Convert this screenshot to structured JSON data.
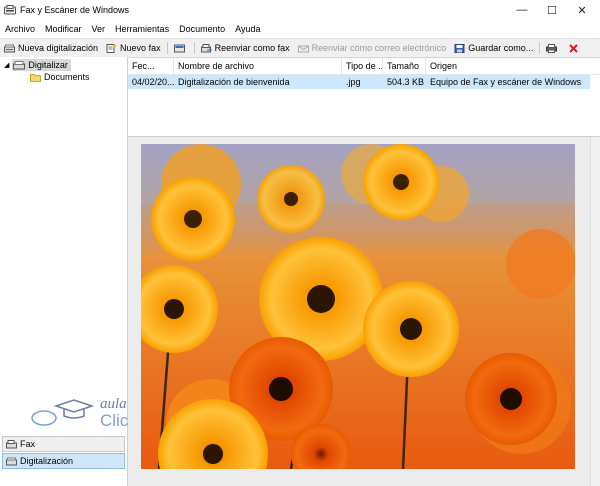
{
  "window": {
    "title": "Fax y Escáner de Windows",
    "minimize": "—",
    "maximize": "☐",
    "close": "✕"
  },
  "menu": [
    "Archivo",
    "Modificar",
    "Ver",
    "Herramientas",
    "Documento",
    "Ayuda"
  ],
  "toolbar": {
    "new_scan": "Nueva digitalización",
    "new_fax": "Nuevo fax",
    "forward_fax": "Reenviar como fax",
    "forward_email": "Reenviar como correo electrónico",
    "save_as": "Guardar como..."
  },
  "tree": {
    "root": "Digitalizar",
    "child": "Documents"
  },
  "nav": {
    "fax": "Fax",
    "scan": "Digitalización"
  },
  "watermark": {
    "text1": "aula",
    "text2": "Clic"
  },
  "file_list": {
    "columns": [
      "Fec...",
      "Nombre de archivo",
      "Tipo de ...",
      "Tamaño",
      "Origen"
    ],
    "rows": [
      {
        "date": "04/02/20...",
        "name": "Digitalización de bienvenida",
        "type": ".jpg",
        "size": "504.3 KB",
        "origin": "Equipo de Fax y escáner de Windows"
      }
    ]
  },
  "colors": {
    "selection": "#cce8ff",
    "toolbar_bg": "#f0f0f0",
    "accent_blue": "#2a6fc0",
    "disabled_text": "#9a9a9a"
  },
  "preview": {
    "subject": "orange daisy flowers photo"
  }
}
